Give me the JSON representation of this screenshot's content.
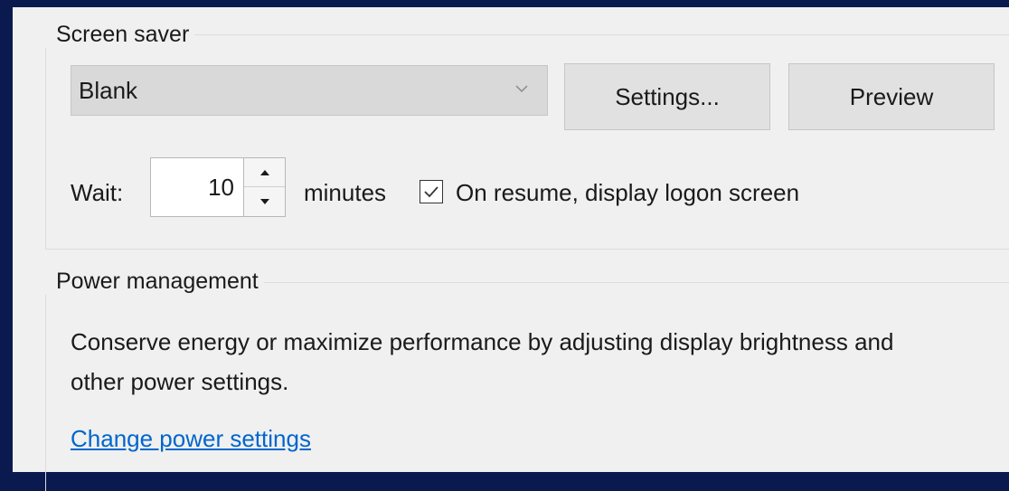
{
  "screen_saver": {
    "title": "Screen saver",
    "selected": "Blank",
    "settings_label": "Settings...",
    "preview_label": "Preview",
    "wait_label": "Wait:",
    "wait_value": "10",
    "minutes_label": "minutes",
    "resume_checked": true,
    "resume_label": "On resume, display logon screen"
  },
  "power": {
    "title": "Power management",
    "description": "Conserve energy or maximize performance by adjusting display brightness and other power settings.",
    "link_label": "Change power settings",
    "link_color": "#0066cc"
  },
  "icons": {
    "dropdown": "chevron-down-icon",
    "spin_up": "arrow-up-icon",
    "spin_down": "arrow-down-icon",
    "checkbox": "checkmark-icon"
  }
}
